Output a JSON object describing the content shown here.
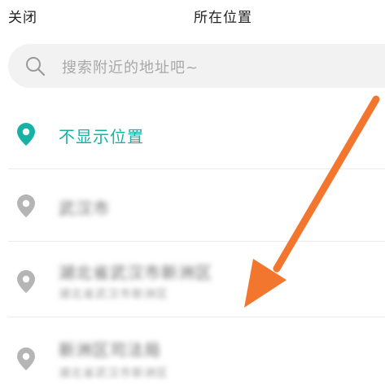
{
  "header": {
    "close_label": "关闭",
    "title": "所在位置"
  },
  "search": {
    "placeholder": "搜索附近的地址吧~"
  },
  "locations": {
    "hide_location_label": "不显示位置",
    "items": [
      {
        "name": "武汉市"
      },
      {
        "name": "湖北省武汉市新洲区",
        "address": "湖北省武汉市新洲区"
      },
      {
        "name": "新洲区司法局",
        "address": "湖北省武汉市新洲区"
      }
    ]
  },
  "colors": {
    "accent": "#17b2a6",
    "arrow": "#f2762e",
    "pin_gray": "#b5b5b5"
  },
  "icons": {
    "search": "search-icon",
    "pin": "location-pin-icon",
    "arrow": "arrow-annotation-icon"
  }
}
